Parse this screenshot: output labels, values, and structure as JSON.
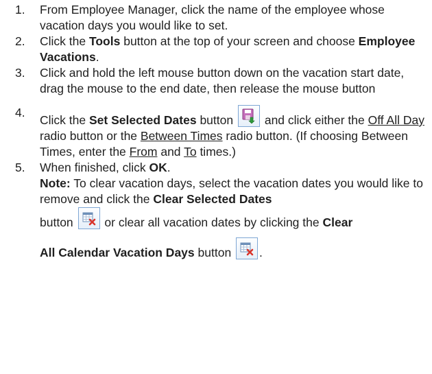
{
  "steps": [
    {
      "num": "1.",
      "text": "From Employee Manager, click the name of the employee whose vacation days you would like to set."
    },
    {
      "num": "2.",
      "pre": "Click the ",
      "bold1": "Tools",
      "mid": " button at the top of your screen and choose ",
      "bold2": "Employee Vacations",
      "post": "."
    },
    {
      "num": "3.",
      "text": "Click and hold the left mouse button down on the vacation start date, drag the mouse to the end date, then release the mouse button"
    },
    {
      "num": "4.",
      "pre": "Click the ",
      "bold1": "Set Selected Dates",
      "mid1": " button ",
      "mid2": " and click either the ",
      "u1": "Off All Day",
      "mid3": " radio button or the ",
      "u2": "Between Times",
      "mid4": " radio button. (If choosing Between Times, enter the ",
      "u3": "From",
      "mid5": " and ",
      "u4": "To",
      "post": " times.)"
    },
    {
      "num": "5.",
      "pre": "When finished, click ",
      "bold1": "OK",
      "post": ".",
      "note_label": "Note:",
      "note_text1": " To clear vacation days, select the vacation dates you would like to remove and click the ",
      "note_bold1": "Clear Selected Dates",
      "note_text2": "button ",
      "note_text3": " or clear all vacation dates by clicking the ",
      "note_bold2": "Clear",
      "note_bold3": "All Calendar Vacation Days",
      "note_text4": " button ",
      "note_end": "."
    }
  ],
  "icons": {
    "set_selected": "save-arrow-icon",
    "clear_selected": "calendar-clear-icon",
    "clear_all": "calendar-clear-all-icon"
  },
  "colors": {
    "icon_border": "#7ea6d4",
    "icon_x": "#d9342b",
    "icon_save": "#b14fa6",
    "icon_arrow": "#2e9a3a"
  }
}
